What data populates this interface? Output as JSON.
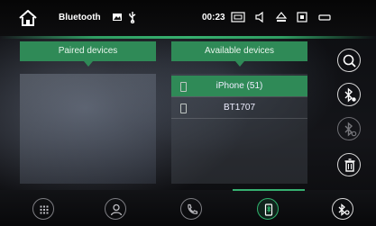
{
  "statusbar": {
    "title": "Bluetooth",
    "time": "00:23"
  },
  "panels": {
    "paired_title": "Paired devices",
    "available_title": "Available devices"
  },
  "available_devices": [
    {
      "name": "iPhone (51)",
      "selected": true
    },
    {
      "name": "BT1707",
      "selected": false
    }
  ],
  "icons": {
    "home": "home-icon",
    "image": "image-icon",
    "usb": "usb-icon",
    "screen": "screen-icon",
    "volume": "volume-icon",
    "eject": "eject-icon",
    "display": "display-icon",
    "window": "window-icon",
    "search": "search-icon",
    "bt_connect": "bluetooth-connect-icon",
    "bt_disconnect": "bluetooth-disconnect-icon",
    "delete": "trash-icon",
    "keypad": "keypad-icon",
    "contacts": "contacts-icon",
    "phone": "phone-icon",
    "bt_music": "bluetooth-music-icon",
    "bt_settings": "bluetooth-settings-icon"
  },
  "colors": {
    "accent_green": "#2f8a57",
    "active_green": "#36b070"
  }
}
